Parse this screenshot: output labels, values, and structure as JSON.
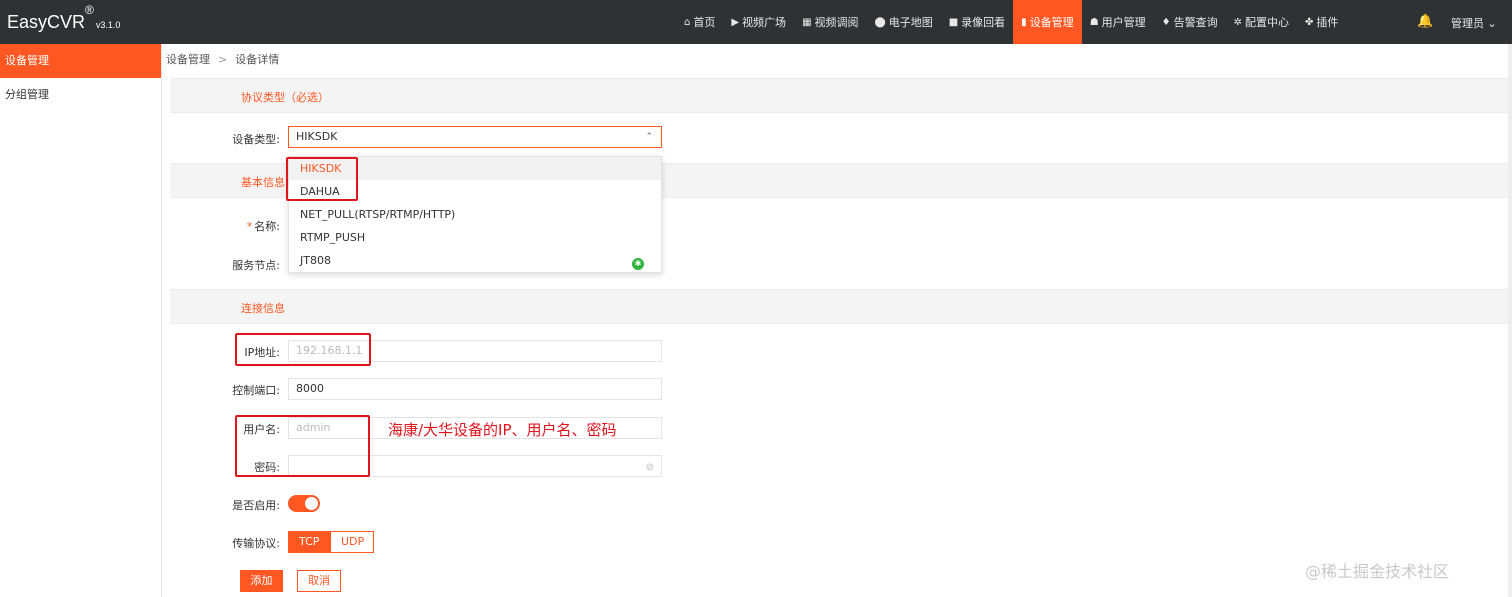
{
  "brand": {
    "name": "EasyCVR",
    "reg": "®",
    "version": "v3.1.0"
  },
  "topnav": [
    {
      "icon": "home-icon",
      "glyph": "⌂",
      "label": "首页"
    },
    {
      "icon": "play-icon",
      "glyph": "▶",
      "label": "视频广场"
    },
    {
      "icon": "grid-icon",
      "glyph": "▦",
      "label": "视频调阅"
    },
    {
      "icon": "map-pin-icon",
      "glyph": "⬤",
      "label": "电子地图"
    },
    {
      "icon": "camera-icon",
      "glyph": "■",
      "label": "录像回看"
    },
    {
      "icon": "device-icon",
      "glyph": "▮",
      "label": "设备管理",
      "active": true
    },
    {
      "icon": "user-icon",
      "glyph": "☗",
      "label": "用户管理"
    },
    {
      "icon": "alarm-icon",
      "glyph": "♦",
      "label": "告警查询"
    },
    {
      "icon": "gear-icon",
      "glyph": "✲",
      "label": "配置中心"
    },
    {
      "icon": "puzzle-icon",
      "glyph": "✤",
      "label": "插件"
    }
  ],
  "user": {
    "label": "管理员",
    "caret": "⌄"
  },
  "sidebar": {
    "items": [
      {
        "label": "设备管理",
        "active": true
      },
      {
        "label": "分组管理"
      }
    ]
  },
  "breadcrumb": {
    "root": "设备管理",
    "sep": ">",
    "current": "设备详情"
  },
  "sections": {
    "protocol": "协议类型（必选）",
    "basic": "基本信息",
    "connection": "连接信息"
  },
  "form": {
    "device_type_label": "设备类型:",
    "device_type_value": "HIKSDK",
    "name_label": "名称:",
    "required_mark": "*",
    "node_label": "服务节点:",
    "ip_label": "IP地址:",
    "ip_placeholder": "192.168.1.1",
    "port_label": "控制端口:",
    "port_value": "8000",
    "username_label": "用户名:",
    "username_placeholder": "admin",
    "password_label": "密码:",
    "enable_label": "是否启用:",
    "transport_label": "传输协议:",
    "tcp": "TCP",
    "udp": "UDP",
    "add": "添加",
    "cancel": "取消"
  },
  "dropdown_options": [
    "HIKSDK",
    "DAHUA",
    "NET_PULL(RTSP/RTMP/HTTP)",
    "RTMP_PUSH",
    "JT808"
  ],
  "annotation": "海康/大华设备的IP、用户名、密码",
  "watermark": "@稀土掘金技术社区",
  "colors": {
    "accent": "#fe5722",
    "topbar": "#2f3234",
    "annotation": "#e0141c"
  }
}
